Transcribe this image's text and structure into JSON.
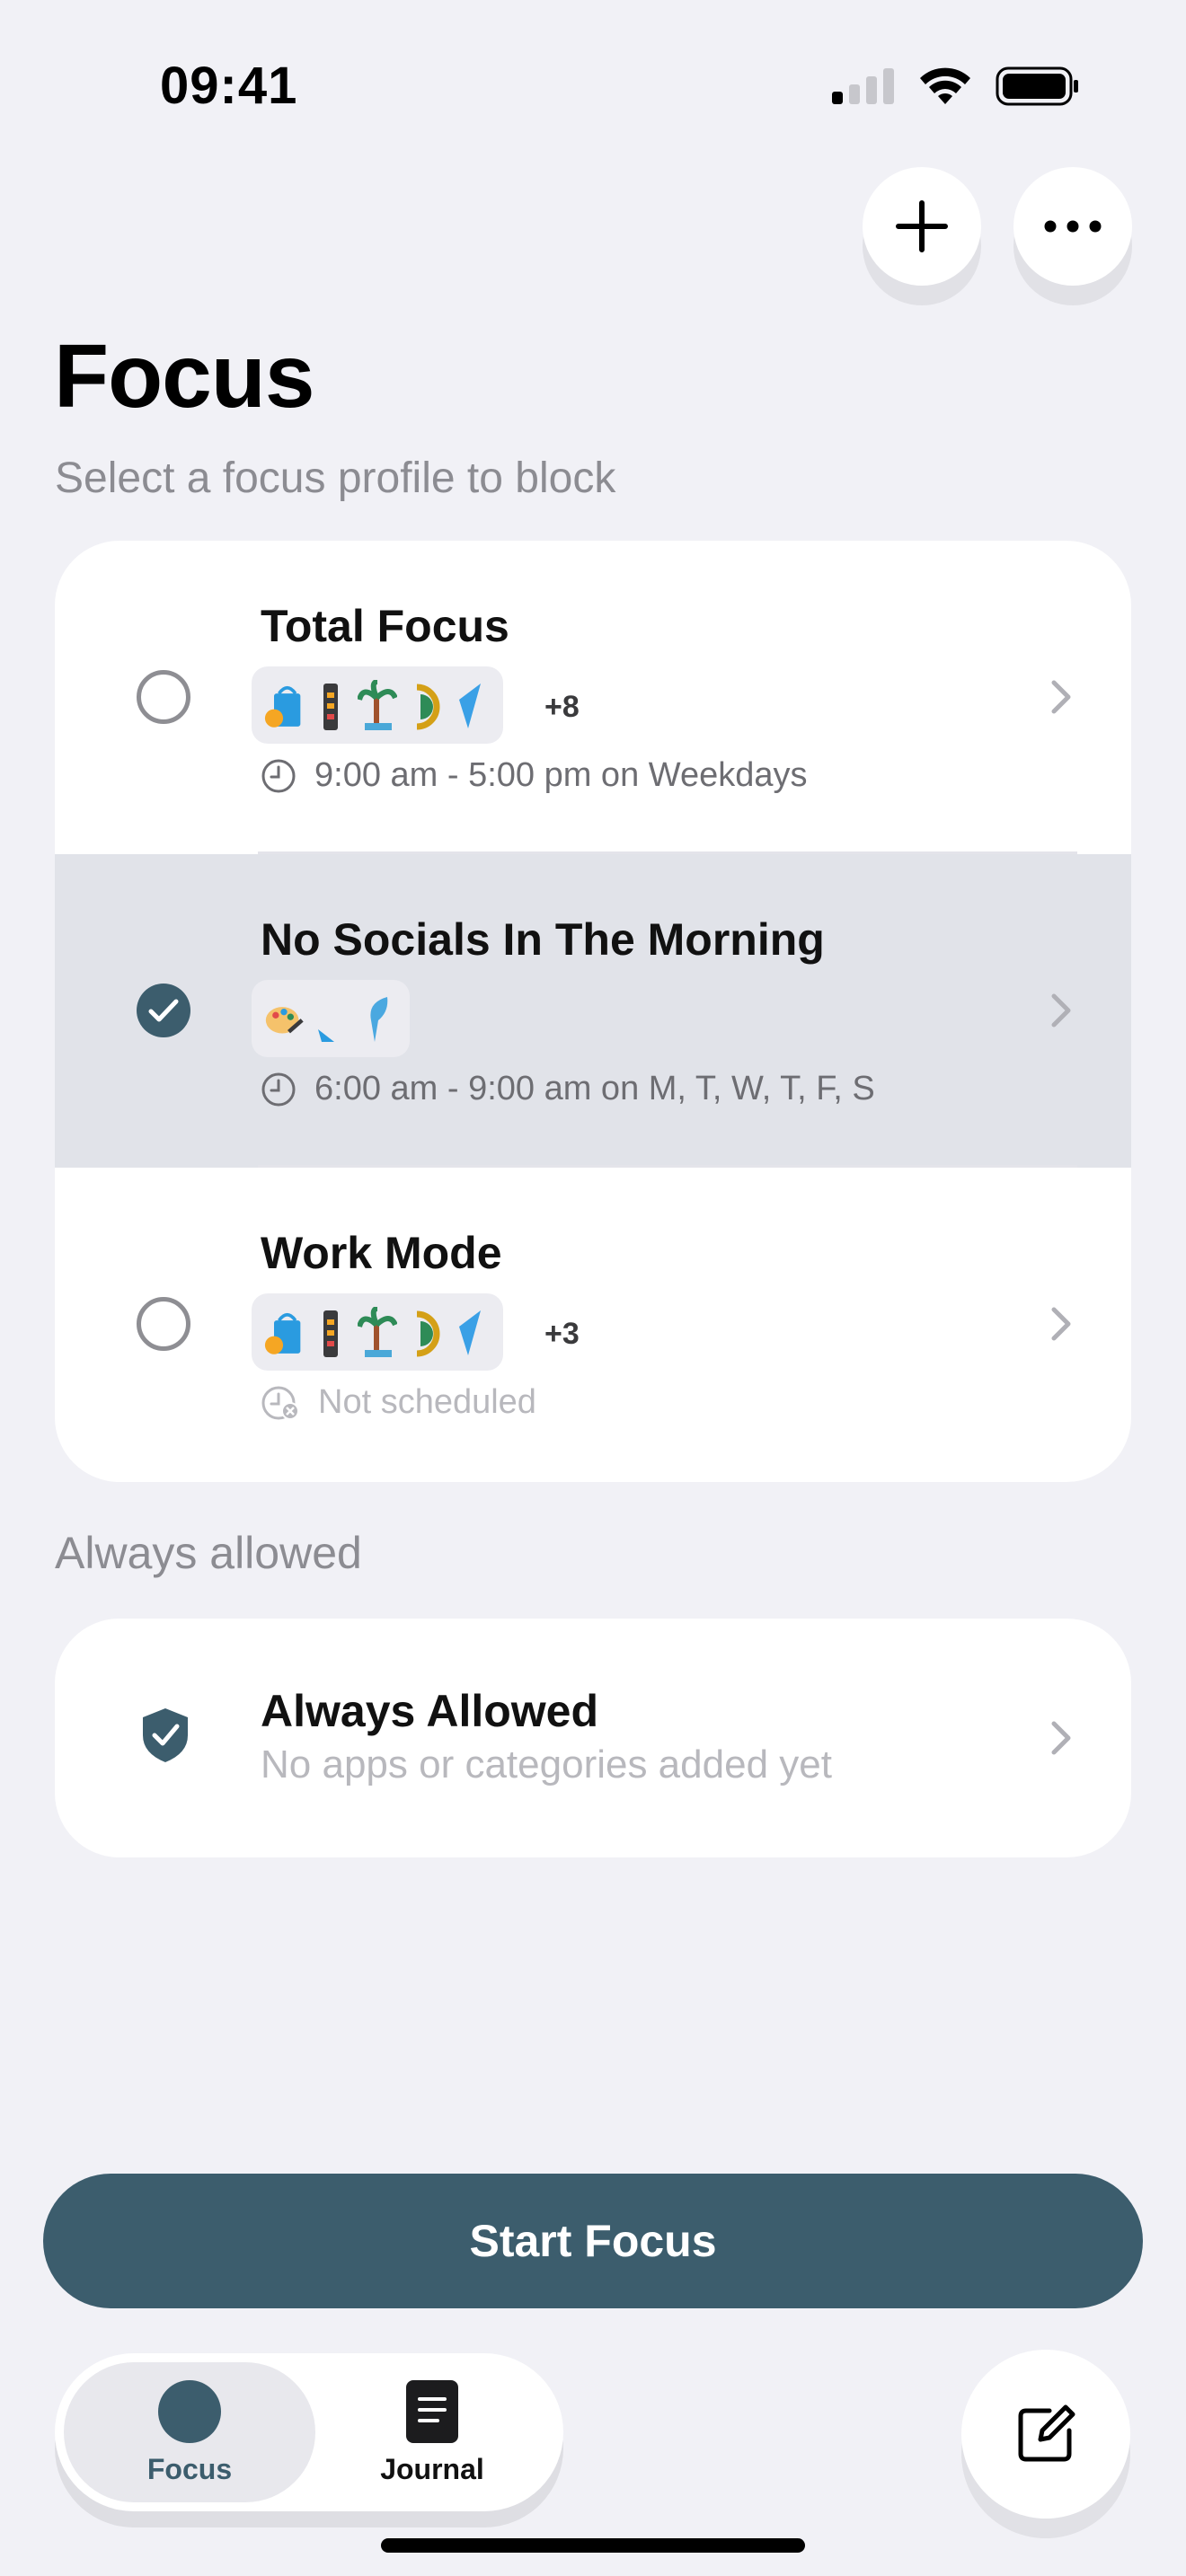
{
  "status_bar": {
    "time": "09:41"
  },
  "header": {
    "add_icon": "plus-icon",
    "more_icon": "ellipsis-icon",
    "title": "Focus",
    "subtitle": "Select a focus profile to block"
  },
  "profiles": [
    {
      "name": "Total Focus",
      "selected": false,
      "apps_extra": "+8",
      "schedule": "9:00 am - 5:00 pm on Weekdays",
      "scheduled": true
    },
    {
      "name": "No Socials In The Morning",
      "selected": true,
      "apps_extra": "",
      "schedule": "6:00 am - 9:00 am on M, T, W, T, F, S",
      "scheduled": true
    },
    {
      "name": "Work Mode",
      "selected": false,
      "apps_extra": "+3",
      "schedule": "Not scheduled",
      "scheduled": false
    }
  ],
  "always_allowed": {
    "section_label": "Always allowed",
    "name": "Always Allowed",
    "subtitle": "No apps or categories added yet"
  },
  "start_button": "Start Focus",
  "tabs": [
    {
      "label": "Focus",
      "active": true
    },
    {
      "label": "Journal",
      "active": false
    }
  ],
  "colors": {
    "accent": "#3c5d6d",
    "background": "#f1f1f6",
    "selected_row": "#e1e3e9"
  }
}
